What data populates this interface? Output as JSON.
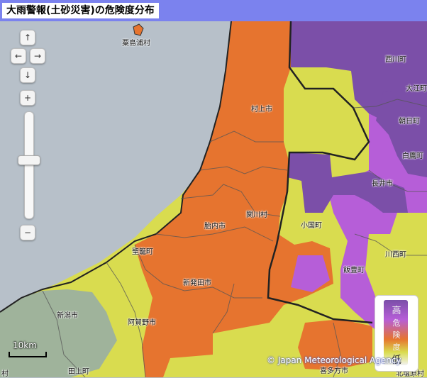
{
  "title": "大雨警報(土砂災害)の危険度分布",
  "colors": {
    "sea": "#b7c0c9",
    "land_low": "#d9dc4f",
    "caution": "#e6742f",
    "warning": "#b65ed8",
    "extreme": "#7b4fa8",
    "plain": "#9fb39b",
    "title_bar": "#7b82ee"
  },
  "controls": {
    "pan_up": "↑",
    "pan_left": "←",
    "pan_right": "→",
    "pan_down": "↓",
    "zoom_in": "+",
    "zoom_out": "−"
  },
  "places": [
    "粟島浦村",
    "西川町",
    "大江町",
    "朝日町",
    "白鷹町",
    "長井市",
    "村上市",
    "関川村",
    "胎内市",
    "小国町",
    "飯豊町",
    "川西町",
    "聖籠町",
    "新発田市",
    "阿賀野市",
    "新潟市",
    "田上町",
    "喜多方市",
    "北塩原村",
    "村"
  ],
  "legend": {
    "high": "高",
    "danger": "危険度",
    "low": "低"
  },
  "scale": {
    "label": "10km"
  },
  "copyright": "© Japan Meteorological Agency"
}
